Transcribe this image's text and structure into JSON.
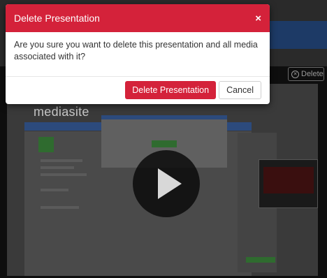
{
  "modal": {
    "title": "Delete Presentation",
    "close_icon": "close-icon",
    "close_glyph": "×",
    "message": "Are you sure you want to delete this presentation and all media associated with it?",
    "confirm_label": "Delete Presentation",
    "cancel_label": "Cancel",
    "accent_color": "#d4223a"
  },
  "background": {
    "delete_label": "Delete",
    "delete_icon": "delete-circle-icon",
    "video_logo": "mediasite",
    "play_icon": "play-icon"
  }
}
